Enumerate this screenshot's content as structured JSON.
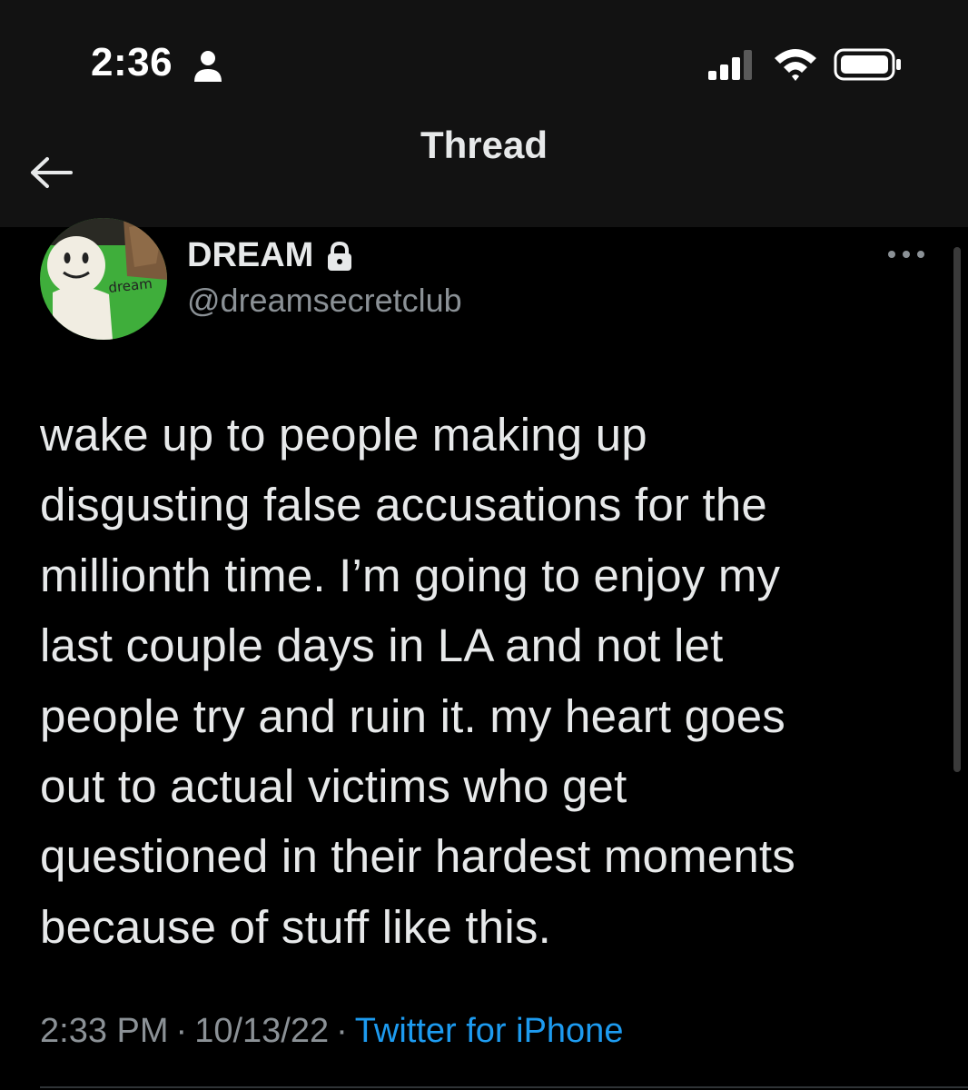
{
  "status_bar": {
    "time": "2:36",
    "icons": [
      "person-icon",
      "signal-icon",
      "wifi-icon",
      "battery-icon"
    ]
  },
  "nav": {
    "title": "Thread",
    "back_icon": "back-arrow-icon"
  },
  "tweet": {
    "display_name": "DREAM",
    "protected_icon": "lock-icon",
    "handle": "@dreamsecretclub",
    "avatar_text": "dream",
    "text": "wake up to people making up\ndisgusting false accusations for the\nmillionth time. I’m going to enjoy my\nlast couple days in LA and not let\npeople try and ruin it. my heart goes\nout to actual victims who get\nquestioned in their hardest moments\nbecause of stuff like this.",
    "time": "2:33 PM",
    "separator": "·",
    "date": "10/13/22",
    "source": "Twitter for iPhone"
  },
  "colors": {
    "background": "#000000",
    "header": "#121212",
    "text": "#e7e9ea",
    "secondary": "#8b9196",
    "link": "#1d9bf0"
  }
}
